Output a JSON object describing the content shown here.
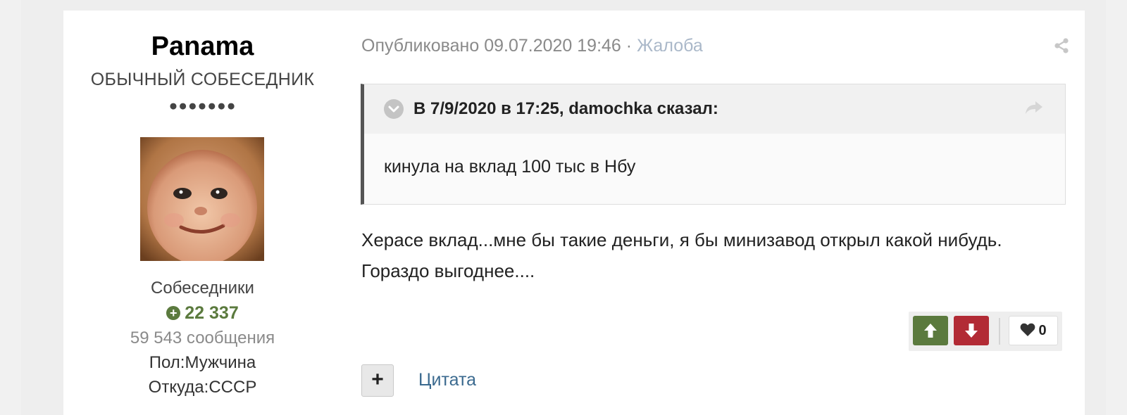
{
  "author": {
    "name": "Panama",
    "rank": "ОБЫЧНЫЙ СОБЕСЕДНИК",
    "rank_pips": "●●●●●●●",
    "group": "Собеседники",
    "reputation": "22 337",
    "post_count": "59 543 сообщения",
    "gender": "Пол:Мужчина",
    "location": "Откуда:СССР"
  },
  "post": {
    "published": "Опубликовано 09.07.2020 19:46",
    "separator": "·",
    "report_label": "Жалоба",
    "quote": {
      "author_line": "В 7/9/2020 в 17:25, damochka сказал:",
      "text": "кинула на вклад 100 тыс в Нбу"
    },
    "text_line1": "Херасе вклад...мне бы такие деньги, я бы минизавод открыл какой нибудь.",
    "text_line2": "Гораздо выгоднее...."
  },
  "reactions": {
    "like_count": "0"
  },
  "actions": {
    "multiquote_label": "+",
    "quote_label": "Цитата"
  },
  "colors": {
    "reputation_green": "#5b7a3e",
    "vote_down_red": "#b22b35",
    "link_blue": "#3b6a8f"
  }
}
